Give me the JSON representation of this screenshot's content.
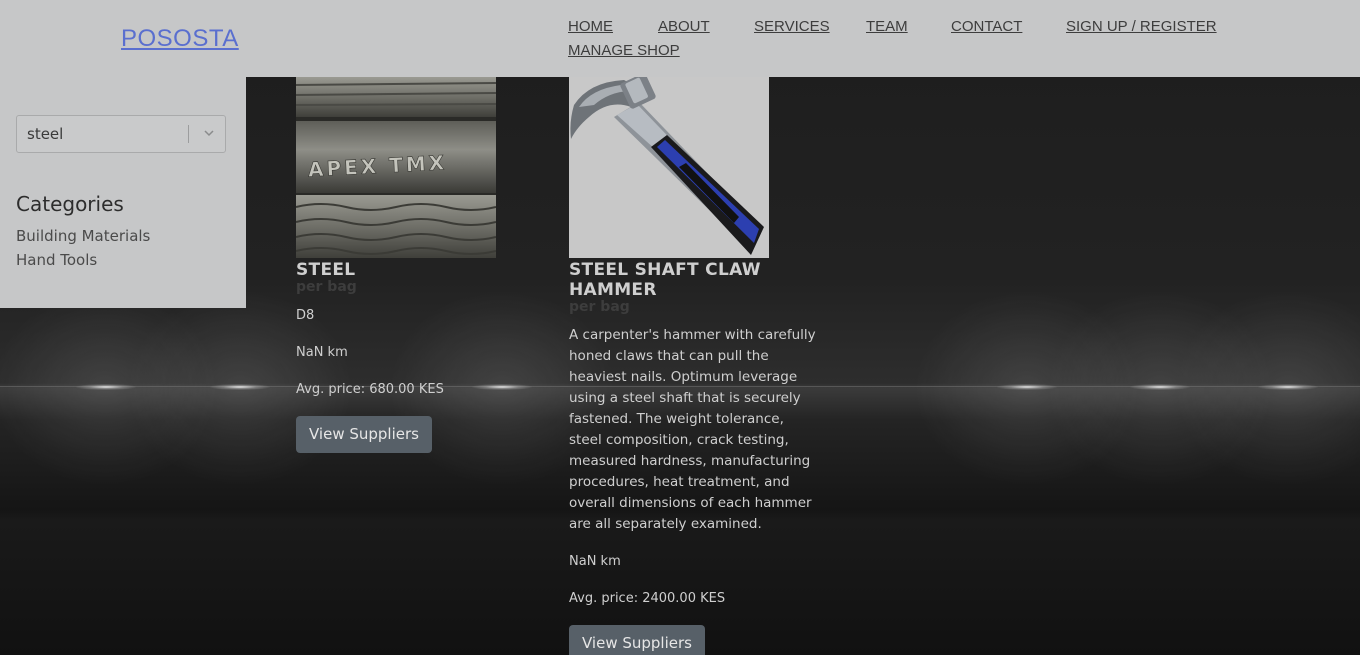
{
  "brand": {
    "logo": "POSOSTA"
  },
  "nav": {
    "items": [
      "HOME",
      "ABOUT",
      "SERVICES",
      "TEAM",
      "CONTACT",
      "SIGN UP / REGISTER",
      "MANAGE SHOP"
    ]
  },
  "sidebar": {
    "search_value": "steel",
    "categories_title": "Categories",
    "categories": [
      "Building Materials",
      "Hand Tools"
    ]
  },
  "products": [
    {
      "name": "STEEL",
      "unit": "per bag",
      "code": "D8",
      "distance": "NaN km",
      "price": "Avg. price: 680.00 KES",
      "button": "View Suppliers",
      "image_text": "APEX TMX"
    },
    {
      "name": "STEEL SHAFT CLAW HAMMER",
      "unit": "per bag",
      "description": "A carpenter's hammer with carefully honed claws that can pull the heaviest nails. Optimum leverage using a steel shaft that is securely fastened. The weight tolerance, steel composition, crack testing, measured hardness, manufacturing procedures, heat treatment, and overall dimensions of each hammer are all separately examined.",
      "distance": "NaN km",
      "price": "Avg. price: 2400.00 KES",
      "button": "View Suppliers"
    }
  ],
  "colors": {
    "header_bg": "#c6c7c8",
    "logo": "#5a6fcf",
    "button_bg": "#576068",
    "hammer_grip": "#2c3fb0"
  }
}
